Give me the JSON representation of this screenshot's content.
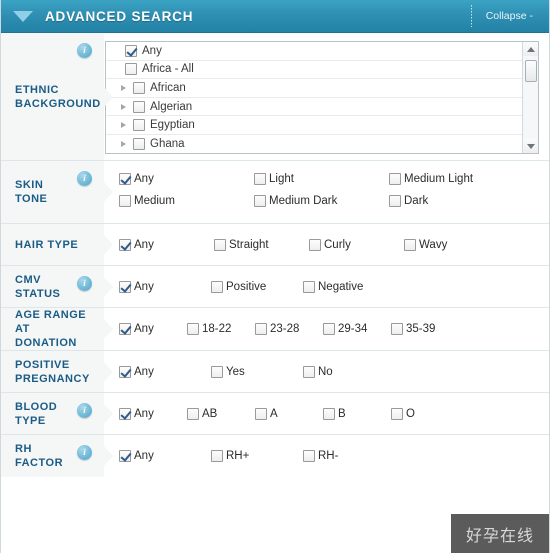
{
  "header": {
    "title": "ADVANCED SEARCH",
    "collapse_label": "Collapse -",
    "caret_icon": "chevron-down-icon",
    "bg_color": "#2f90b3",
    "text_color": "#ffffff"
  },
  "theme": {
    "label_text_color": "#1a5c86",
    "label_bg_color": "#f5f6f6",
    "row_border_color": "#dde6ea",
    "info_icon_color": "#7cc0dc",
    "check_color": "#2e5c8a"
  },
  "rows": [
    {
      "id": "ethnic-background",
      "label": "ETHNIC\nBACKGROUND",
      "has_info": true,
      "type": "tree",
      "tree": {
        "items": [
          {
            "label": "Any",
            "checked": true,
            "indent": false,
            "expander": false
          },
          {
            "label": "Africa - All",
            "checked": false,
            "indent": false,
            "expander": false
          },
          {
            "label": "African",
            "checked": false,
            "indent": true,
            "expander": true
          },
          {
            "label": "Algerian",
            "checked": false,
            "indent": true,
            "expander": true
          },
          {
            "label": "Egyptian",
            "checked": false,
            "indent": true,
            "expander": true
          },
          {
            "label": "Ghana",
            "checked": false,
            "indent": true,
            "expander": true
          }
        ],
        "scrollbar": {
          "up_icon": "arrow-up-icon",
          "down_icon": "arrow-down-icon",
          "thumb_position": "top"
        }
      }
    },
    {
      "id": "skin-tone",
      "label": "SKIN\nTONE",
      "has_info": true,
      "type": "checkbox-grid",
      "cols_class": "cols-6 stack-rows",
      "options": [
        {
          "label": "Any",
          "checked": true
        },
        {
          "label": "Light",
          "checked": false
        },
        {
          "label": "Medium Light",
          "checked": false
        },
        {
          "label": "Medium",
          "checked": false
        },
        {
          "label": "Medium Dark",
          "checked": false
        },
        {
          "label": "Dark",
          "checked": false
        }
      ]
    },
    {
      "id": "hair-type",
      "label": "HAIR TYPE",
      "has_info": false,
      "type": "checkbox-grid",
      "cols_class": "cols-4b",
      "options": [
        {
          "label": "Any",
          "checked": true
        },
        {
          "label": "Straight",
          "checked": false
        },
        {
          "label": "Curly",
          "checked": false
        },
        {
          "label": "Wavy",
          "checked": false
        }
      ]
    },
    {
      "id": "cmv-status",
      "label": "CMV\nSTATUS",
      "has_info": true,
      "type": "checkbox-grid",
      "cols_class": "cols-3",
      "options": [
        {
          "label": "Any",
          "checked": true
        },
        {
          "label": "Positive",
          "checked": false
        },
        {
          "label": "Negative",
          "checked": false
        }
      ]
    },
    {
      "id": "age-range-at-donation",
      "label": "AGE RANGE\nAT DONATION",
      "has_info": false,
      "type": "checkbox-grid",
      "cols_class": "cols-5",
      "options": [
        {
          "label": "Any",
          "checked": true
        },
        {
          "label": "18-22",
          "checked": false
        },
        {
          "label": "23-28",
          "checked": false
        },
        {
          "label": "29-34",
          "checked": false
        },
        {
          "label": "35-39",
          "checked": false
        }
      ]
    },
    {
      "id": "positive-pregnancy",
      "label": "POSITIVE\nPREGNANCY",
      "has_info": false,
      "type": "checkbox-grid",
      "cols_class": "cols-3",
      "options": [
        {
          "label": "Any",
          "checked": true
        },
        {
          "label": "Yes",
          "checked": false
        },
        {
          "label": "No",
          "checked": false
        }
      ]
    },
    {
      "id": "blood-type",
      "label": "BLOOD\nTYPE",
      "has_info": true,
      "type": "checkbox-grid",
      "cols_class": "cols-5",
      "options": [
        {
          "label": "Any",
          "checked": true
        },
        {
          "label": "AB",
          "checked": false
        },
        {
          "label": "A",
          "checked": false
        },
        {
          "label": "B",
          "checked": false
        },
        {
          "label": "O",
          "checked": false
        }
      ]
    },
    {
      "id": "rh-factor",
      "label": "RH\nFACTOR",
      "has_info": true,
      "type": "checkbox-grid",
      "cols_class": "cols-3",
      "options": [
        {
          "label": "Any",
          "checked": true
        },
        {
          "label": "RH+",
          "checked": false
        },
        {
          "label": "RH-",
          "checked": false
        }
      ]
    }
  ],
  "watermark": {
    "text": "好孕在线",
    "bg_color": "#5b5b5b",
    "text_color": "#d8d8d8"
  }
}
